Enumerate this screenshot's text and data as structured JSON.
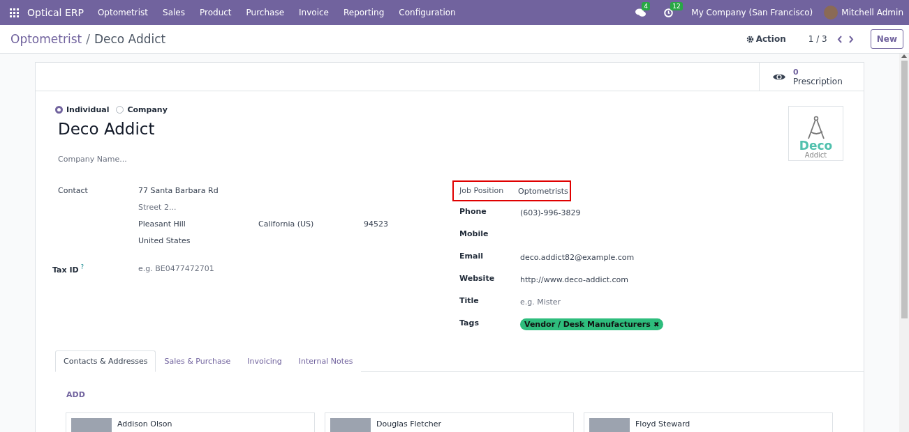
{
  "navbar": {
    "app_name": "Optical ERP",
    "menu": [
      "Optometrist",
      "Sales",
      "Product",
      "Purchase",
      "Invoice",
      "Reporting",
      "Configuration"
    ],
    "messages_count": "4",
    "activities_count": "12",
    "company": "My Company (San Francisco)",
    "user": "Mitchell Admin"
  },
  "control_panel": {
    "separator": "/",
    "breadcrumb": [
      {
        "label": "Optometrist",
        "kind": "link"
      },
      {
        "label": "Deco Addict",
        "kind": "current"
      }
    ],
    "action": "Action",
    "pager": "1 / 3",
    "new_button": "New"
  },
  "stat_button": {
    "value": "0",
    "label": "Prescription"
  },
  "company_type": [
    {
      "label": "Individual",
      "selected": true
    },
    {
      "label": "Company",
      "selected": false
    }
  ],
  "name": "Deco Addict",
  "company_name": {
    "placeholder": "Company Name..."
  },
  "logo": {
    "title": "Deco",
    "subtitle": "Addict"
  },
  "contact": {
    "label": "Contact",
    "street": "77 Santa Barbara Rd",
    "street2": {
      "placeholder": "Street 2..."
    },
    "city": "Pleasant Hill",
    "state": "California (US)",
    "zip": "94523",
    "country": "United States"
  },
  "tax_id": {
    "label": "Tax ID",
    "help": "?",
    "placeholder": "e.g. BE0477472701"
  },
  "right_fields": [
    {
      "kind": "text",
      "label": "Job Position",
      "value": "Optometrists",
      "highlighted": true
    },
    {
      "kind": "text",
      "label": "Phone",
      "value": "(603)-996-3829",
      "highlighted": false
    },
    {
      "kind": "text",
      "label": "Mobile",
      "highlighted": false
    },
    {
      "kind": "text",
      "label": "Email",
      "value": "deco.addict82@example.com",
      "highlighted": false
    },
    {
      "kind": "text",
      "label": "Website",
      "value": "http://www.deco-addict.com",
      "highlighted": false
    },
    {
      "kind": "placeholder",
      "label": "Title",
      "placeholder": "e.g. Mister",
      "highlighted": false
    },
    {
      "kind": "tags",
      "label": "Tags",
      "tags": [
        {
          "label": "Vendor / Desk Manufacturers",
          "remove": "✖",
          "color": "#2ebd7d"
        }
      ],
      "highlighted": false
    }
  ],
  "tabs": [
    {
      "label": "Contacts & Addresses",
      "selected": true
    },
    {
      "label": "Sales & Purchase",
      "selected": false
    },
    {
      "label": "Invoicing",
      "selected": false
    },
    {
      "label": "Internal Notes",
      "selected": false
    }
  ],
  "add_button": "ADD",
  "contacts": [
    {
      "name": "Addison Olson"
    },
    {
      "name": "Douglas Fletcher"
    },
    {
      "name": "Floyd Steward"
    }
  ]
}
